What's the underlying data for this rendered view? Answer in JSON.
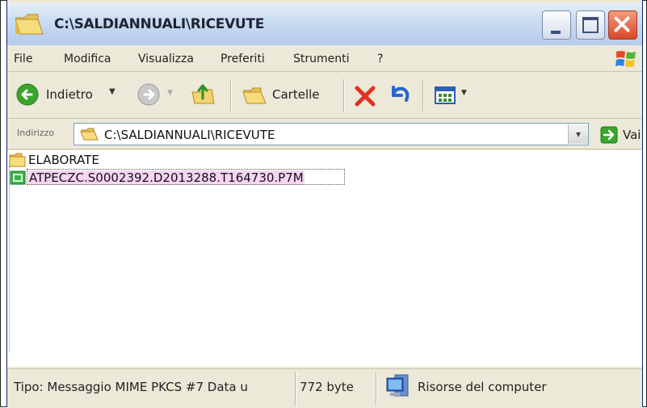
{
  "window": {
    "title": "C:\\SALDIANNUALI\\RICEVUTE"
  },
  "menubar": {
    "items": [
      "File",
      "Modifica",
      "Visualizza",
      "Preferiti",
      "Strumenti",
      "?"
    ]
  },
  "toolbar": {
    "back_label": "Indietro",
    "folders_label": "Cartelle"
  },
  "addressbar": {
    "label": "Indirizzo",
    "value": "C:\\SALDIANNUALI\\RICEVUTE",
    "go_label": "Vai"
  },
  "files": [
    {
      "name": "ELABORATE",
      "icon": "folder-icon",
      "selected": false
    },
    {
      "name": "ATPECZC.S0002392.D2013288.T164730.P7M",
      "icon": "file-icon",
      "selected": true
    }
  ],
  "statusbar": {
    "type_text": "Tipo: Messaggio MIME PKCS #7 Data u",
    "size_text": "772 byte",
    "location_text": "Risorse del computer"
  },
  "colors": {
    "selection_highlight": "#f6d5f1",
    "titlebar": "#c9dbf1",
    "close_button": "#d8472a",
    "back_arrow": "#3aa52d"
  }
}
